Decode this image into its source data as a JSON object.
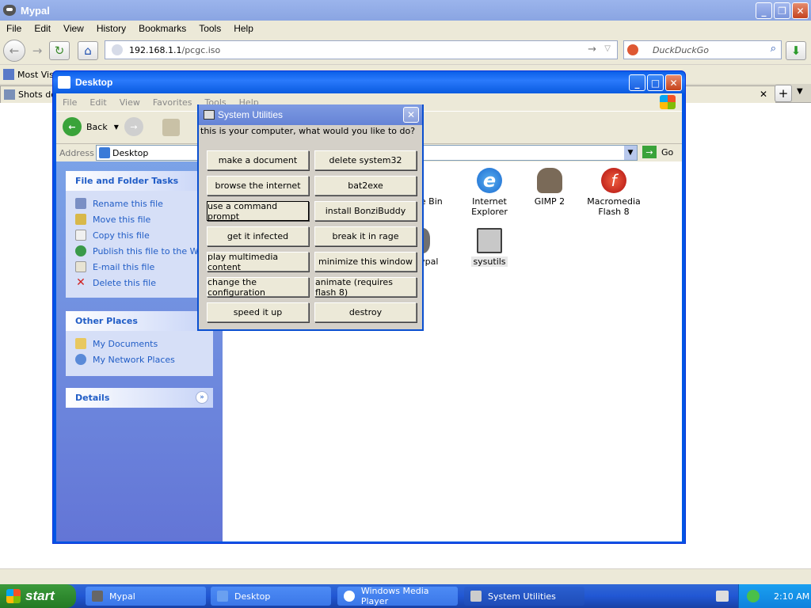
{
  "firefox": {
    "title": "Mypal",
    "menu": [
      "File",
      "Edit",
      "View",
      "History",
      "Bookmarks",
      "Tools",
      "Help"
    ],
    "url_host": "192.168.1.1",
    "url_path": "/pcgc.iso",
    "search_placeholder": "DuckDuckGo",
    "bookmark": "Most Visi",
    "tab": "Shots do"
  },
  "explorer": {
    "title": "Desktop",
    "menu": [
      "File",
      "Edit",
      "View",
      "Favorites",
      "Tools",
      "Help"
    ],
    "back_label": "Back",
    "address_label": "Address",
    "address_value": "Desktop",
    "go_label": "Go",
    "file_tasks": {
      "title": "File and Folder Tasks",
      "items": [
        "Rename this file",
        "Move this file",
        "Copy this file",
        "Publish this file to the Web",
        "E-mail this file",
        "Delete this file"
      ]
    },
    "other_places": {
      "title": "Other Places",
      "items": [
        "My Documents",
        "My Network Places"
      ]
    },
    "details_title": "Details",
    "icons": [
      "ycle Bin",
      "Internet Explorer",
      "GIMP 2",
      "Macromedia Flash 8",
      "Mypal",
      "sysutils"
    ]
  },
  "dialog": {
    "title": "System Utilities",
    "prompt": "this is your computer, what would you like to do?",
    "buttons": [
      "make a document",
      "delete system32",
      "browse the internet",
      "bat2exe",
      "use a command prompt",
      "install BonziBuddy",
      "get it infected",
      "break it in rage",
      "play multimedia content",
      "minimize this window",
      "change the configuration",
      "animate (requires flash 8)",
      "speed it up",
      "destroy"
    ]
  },
  "taskbar": {
    "start_label": "start",
    "tasks": [
      "Mypal",
      "Desktop",
      "Windows Media Player",
      "System Utilities"
    ],
    "clock": "2:10 AM"
  },
  "colors": {
    "xp_blue": "#0055e5",
    "taskbar": "#2157d4",
    "start_green": "#2f8a2f"
  }
}
